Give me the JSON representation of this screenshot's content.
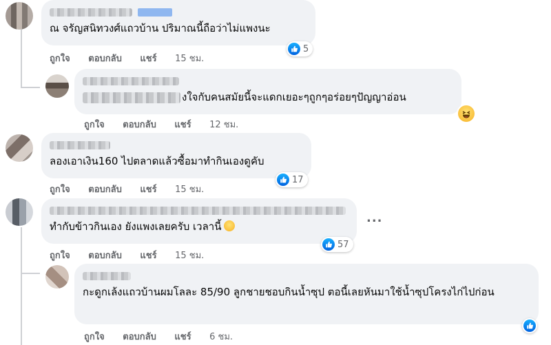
{
  "comments": [
    {
      "text": "ณ จรัญสนิทวงศ์แถวบ้าน ปริมาณนี้ถือว่าไม่แพงนะ",
      "like": "ถูกใจ",
      "reply": "ตอบกลับ",
      "share": "แชร์",
      "time": "15 ชม.",
      "reaction_count": "5"
    },
    {
      "text": "งใจกับคนสมัยนี้จะแดกเยอะๆถูกๆอร่อยๆปัญญาอ่อน",
      "like": "ถูกใจ",
      "reply": "ตอบกลับ",
      "share": "แชร์",
      "time": "12 ชม."
    },
    {
      "text": "ลองเอาเงิน160 ไปตลาดแล้วซื้อมาทำกินเองดูคับ",
      "like": "ถูกใจ",
      "reply": "ตอบกลับ",
      "share": "แชร์",
      "time": "15 ชม.",
      "reaction_count": "17"
    },
    {
      "text": "ทำกับข้าวกินเอง ยังแพงเลยครับ เวลานี้",
      "like": "ถูกใจ",
      "reply": "ตอบกลับ",
      "share": "แชร์",
      "time": "15 ชม.",
      "reaction_count": "57",
      "more": "..."
    },
    {
      "text": "กะดูกเล้งแถวบ้านผมโลละ 85/90 ลูกชายชอบกินน้ำซุป ตอนี้เลยหันมาใช้น้ำซุปโครงไก่ไปก่อน",
      "like": "ถูกใจ",
      "reply": "ตอบกลับ",
      "share": "แชร์",
      "time": "6 ชม."
    }
  ],
  "icons": {
    "like": "like-icon",
    "haha": "haha-icon",
    "more": "more-options-icon"
  },
  "colors": {
    "bubble": "#f0f2f5",
    "meta_text": "#65676b",
    "like_blue": "#0866ff"
  }
}
